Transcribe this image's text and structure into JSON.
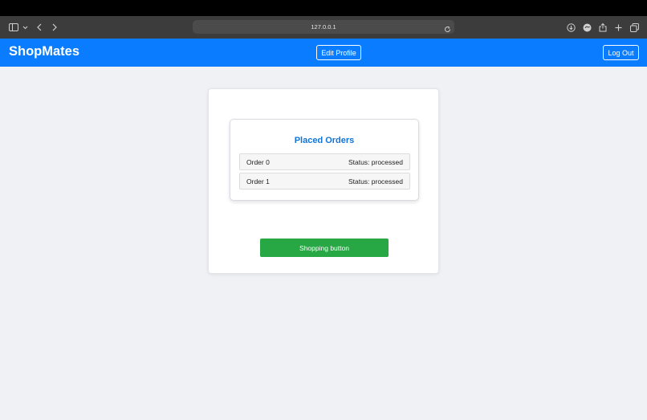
{
  "browser": {
    "url": "127.0.0.1",
    "icons": [
      "sidebar-icon",
      "chevron-down-icon",
      "back-icon",
      "forward-icon",
      "reload-icon",
      "download-icon",
      "chat-icon",
      "share-icon",
      "new-tab-icon",
      "tabs-overview-icon"
    ]
  },
  "navbar": {
    "brand": "ShopMates",
    "edit_profile_label": "Edit Profile",
    "logout_label": "Log Out",
    "background_color": "#0a7cff"
  },
  "orders": {
    "title": "Placed Orders",
    "items": [
      {
        "name": "Order 0",
        "status": "Status: processed"
      },
      {
        "name": "Order 1",
        "status": "Status: processed"
      }
    ]
  },
  "actions": {
    "shopping_label": "Shopping button",
    "shopping_color": "#28a745"
  }
}
